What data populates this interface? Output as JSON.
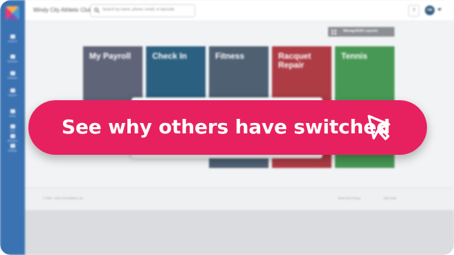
{
  "header": {
    "club_name": "Windy City Athletic Club",
    "search_placeholder": "Search by name, phone, email, or barcode",
    "help_label": "?",
    "user_initials": "HB"
  },
  "sidebar": {
    "items": [
      {
        "label": "Check In",
        "icon": "check-in-icon"
      },
      {
        "label": "Schedule",
        "icon": "schedule-icon"
      },
      {
        "label": "Childcare",
        "icon": "childcare-icon"
      },
      {
        "label": "Reports",
        "icon": "reports-icon"
      },
      {
        "label": "Setup",
        "icon": "setup-icon"
      },
      {
        "label": "POS",
        "icon": "pos-icon"
      },
      {
        "label": "Members",
        "icon": "members-icon"
      },
      {
        "label": "Settings",
        "icon": "settings-icon"
      }
    ]
  },
  "toolbar": {
    "manage_layouts_label": "Manage/Edit Layouts"
  },
  "tiles": [
    {
      "label": "My Payroll",
      "color": "#4a4f66"
    },
    {
      "label": "Check In",
      "color": "#0f4a70"
    },
    {
      "label": "Fitness",
      "color": "#374a60"
    },
    {
      "label": "Racquet Repair",
      "color": "#a3222c"
    },
    {
      "label": "Tennis",
      "color": "#2e8a3e"
    }
  ],
  "footer": {
    "copyright": "© 2002 - 2023 CSI Software, Inc.",
    "privacy": "Terms and Privacy",
    "help_link": "Help Desk"
  },
  "cta": {
    "label": "See why others have switched",
    "color": "#e7215f",
    "icon": "cursor-icon"
  }
}
